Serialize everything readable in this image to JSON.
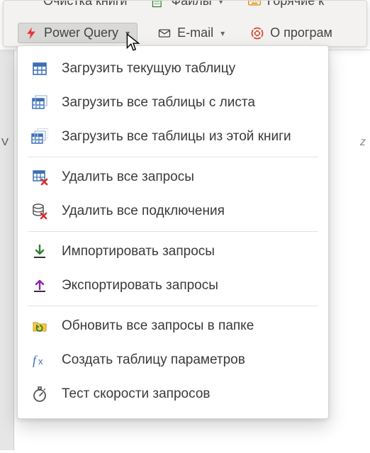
{
  "ribbon_top": {
    "clean_book": "Очистка книги",
    "files": "Файлы",
    "hotkeys": "Горячие к"
  },
  "ribbon_bottom": {
    "power_query": "Power Query",
    "email": "E-mail",
    "about": "О програм"
  },
  "bg": {
    "row_label": "V",
    "fx_hint": "z"
  },
  "menu": {
    "items": [
      {
        "label": "Загрузить текущую таблицу"
      },
      {
        "label": "Загрузить все таблицы с листа"
      },
      {
        "label": "Загрузить все таблицы из этой книги"
      }
    ],
    "items2": [
      {
        "label": "Удалить все запросы"
      },
      {
        "label": "Удалить все подключения"
      }
    ],
    "items3": [
      {
        "label": "Импортировать запросы"
      },
      {
        "label": "Экспортировать запросы"
      }
    ],
    "items4": [
      {
        "label": "Обновить все запросы в папке"
      },
      {
        "label": "Создать таблицу параметров"
      },
      {
        "label": "Тест скорости запросов"
      }
    ]
  }
}
